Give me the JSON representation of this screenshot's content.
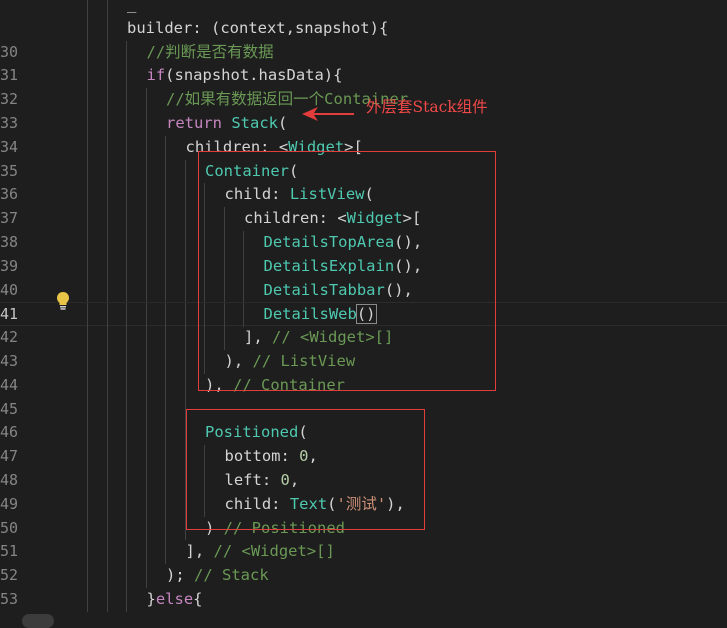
{
  "editor": {
    "lines": [
      {
        "n": "",
        "indent": 6,
        "tokens": [
          {
            "t": "plain",
            "s": "_"
          }
        ]
      },
      {
        "n": "",
        "indent": 6,
        "tokens": [
          {
            "t": "plain",
            "s": "builder: (context,snapshot){"
          }
        ]
      },
      {
        "n": "30",
        "indent": 7,
        "tokens": [
          {
            "t": "comment",
            "s": "//判断是否有数据"
          }
        ]
      },
      {
        "n": "31",
        "indent": 7,
        "tokens": [
          {
            "t": "kw",
            "s": "if"
          },
          {
            "t": "plain",
            "s": "(snapshot.hasData){"
          }
        ]
      },
      {
        "n": "32",
        "indent": 8,
        "tokens": [
          {
            "t": "comment",
            "s": "//如果有数据返回一个Container"
          }
        ]
      },
      {
        "n": "33",
        "indent": 8,
        "tokens": [
          {
            "t": "kw",
            "s": "return"
          },
          {
            "t": "plain",
            "s": " "
          },
          {
            "t": "type",
            "s": "Stack"
          },
          {
            "t": "plain",
            "s": "("
          }
        ]
      },
      {
        "n": "34",
        "indent": 9,
        "tokens": [
          {
            "t": "plain",
            "s": "children: <"
          },
          {
            "t": "type",
            "s": "Widget"
          },
          {
            "t": "plain",
            "s": ">["
          }
        ]
      },
      {
        "n": "35",
        "indent": 10,
        "tokens": [
          {
            "t": "type",
            "s": "Container"
          },
          {
            "t": "plain",
            "s": "("
          }
        ]
      },
      {
        "n": "36",
        "indent": 11,
        "tokens": [
          {
            "t": "plain",
            "s": "child: "
          },
          {
            "t": "type",
            "s": "ListView"
          },
          {
            "t": "plain",
            "s": "("
          }
        ]
      },
      {
        "n": "37",
        "indent": 12,
        "tokens": [
          {
            "t": "plain",
            "s": "children: <"
          },
          {
            "t": "type",
            "s": "Widget"
          },
          {
            "t": "plain",
            "s": ">["
          }
        ]
      },
      {
        "n": "38",
        "indent": 13,
        "tokens": [
          {
            "t": "type",
            "s": "DetailsTopArea"
          },
          {
            "t": "plain",
            "s": "(),"
          }
        ]
      },
      {
        "n": "39",
        "indent": 13,
        "tokens": [
          {
            "t": "type",
            "s": "DetailsExplain"
          },
          {
            "t": "plain",
            "s": "(),"
          }
        ]
      },
      {
        "n": "40",
        "indent": 13,
        "tokens": [
          {
            "t": "type",
            "s": "DetailsTabbar"
          },
          {
            "t": "plain",
            "s": "(),"
          }
        ]
      },
      {
        "n": "41",
        "indent": 13,
        "active": true,
        "tokens": [
          {
            "t": "type",
            "s": "DetailsWeb"
          },
          {
            "t": "cursor",
            "s": "()"
          }
        ]
      },
      {
        "n": "42",
        "indent": 12,
        "tokens": [
          {
            "t": "plain",
            "s": "], "
          },
          {
            "t": "comment",
            "s": "// <Widget>[]"
          }
        ]
      },
      {
        "n": "43",
        "indent": 11,
        "tokens": [
          {
            "t": "plain",
            "s": "), "
          },
          {
            "t": "comment",
            "s": "// ListView"
          }
        ]
      },
      {
        "n": "44",
        "indent": 10,
        "tokens": [
          {
            "t": "plain",
            "s": "), "
          },
          {
            "t": "comment",
            "s": "// Container"
          }
        ]
      },
      {
        "n": "45",
        "indent": 10,
        "tokens": []
      },
      {
        "n": "46",
        "indent": 10,
        "tokens": [
          {
            "t": "type",
            "s": "Positioned"
          },
          {
            "t": "plain",
            "s": "("
          }
        ]
      },
      {
        "n": "47",
        "indent": 11,
        "tokens": [
          {
            "t": "plain",
            "s": "bottom: "
          },
          {
            "t": "num",
            "s": "0"
          },
          {
            "t": "plain",
            "s": ","
          }
        ]
      },
      {
        "n": "48",
        "indent": 11,
        "tokens": [
          {
            "t": "plain",
            "s": "left: "
          },
          {
            "t": "num",
            "s": "0"
          },
          {
            "t": "plain",
            "s": ","
          }
        ]
      },
      {
        "n": "49",
        "indent": 11,
        "tokens": [
          {
            "t": "plain",
            "s": "child: "
          },
          {
            "t": "type",
            "s": "Text"
          },
          {
            "t": "plain",
            "s": "("
          },
          {
            "t": "str",
            "s": "'测试'"
          },
          {
            "t": "plain",
            "s": "),"
          }
        ]
      },
      {
        "n": "50",
        "indent": 10,
        "tokens": [
          {
            "t": "plain",
            "s": ") "
          },
          {
            "t": "comment",
            "s": "// Positioned"
          }
        ]
      },
      {
        "n": "51",
        "indent": 9,
        "tokens": [
          {
            "t": "plain",
            "s": "], "
          },
          {
            "t": "comment",
            "s": "// <Widget>[]"
          }
        ]
      },
      {
        "n": "52",
        "indent": 8,
        "tokens": [
          {
            "t": "plain",
            "s": "); "
          },
          {
            "t": "comment",
            "s": "// Stack"
          }
        ]
      },
      {
        "n": "53",
        "indent": 7,
        "tokens": [
          {
            "t": "plain",
            "s": "}"
          },
          {
            "t": "kw",
            "s": "else"
          },
          {
            "t": "plain",
            "s": "{"
          }
        ]
      }
    ]
  },
  "annotation": {
    "text": "外层套Stack组件",
    "color": "#f04848"
  },
  "icons": {
    "lightbulb": "lightbulb-icon",
    "arrow": "arrow-left-icon"
  },
  "colors": {
    "background": "#1e1e1e",
    "keyword": "#c586c0",
    "type": "#4ec9b0",
    "comment": "#6a9955",
    "highlight_box": "#e23d3d"
  }
}
